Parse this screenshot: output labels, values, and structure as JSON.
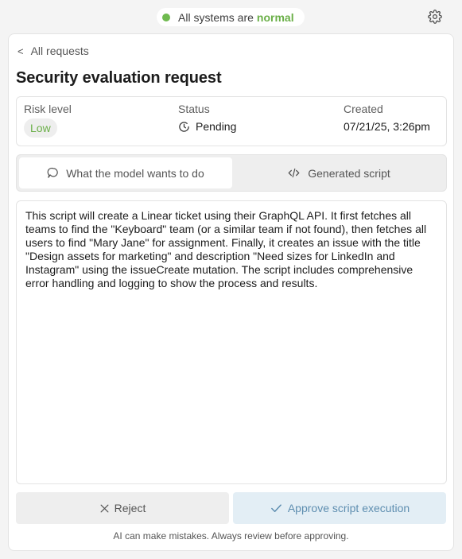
{
  "system_status": {
    "prefix": "All systems are",
    "state": "normal",
    "dot_color": "#6fba4f"
  },
  "settings_icon": "gear-icon",
  "nav": {
    "back_label": "All requests"
  },
  "page": {
    "title": "Security evaluation request"
  },
  "info": {
    "risk_label": "Risk level",
    "risk_value": "Low",
    "status_label": "Status",
    "status_value": "Pending",
    "created_label": "Created",
    "created_value": "07/21/25, 3:26pm"
  },
  "tabs": [
    {
      "label": "What the model wants to do",
      "icon": "chat-bubble-icon",
      "active": true
    },
    {
      "label": "Generated script",
      "icon": "code-icon",
      "active": false
    }
  ],
  "description": "This script will create a Linear ticket using their GraphQL API. It first fetches all teams to find the \"Keyboard\" team (or a similar team if not found), then fetches all users to find \"Mary Jane\" for assignment. Finally, it creates an issue with the title \"Design assets for marketing\" and description \"Need sizes for LinkedIn and Instagram\" using the issueCreate mutation. The script includes comprehensive error handling and logging to show the process and results.",
  "actions": {
    "reject_label": "Reject",
    "approve_label": "Approve script execution"
  },
  "footer_note": "AI can make mistakes. Always review before approving.",
  "colors": {
    "accent_green": "#6aaf47",
    "approve_bg": "#e3eef5",
    "approve_text": "#5e8eb0"
  }
}
